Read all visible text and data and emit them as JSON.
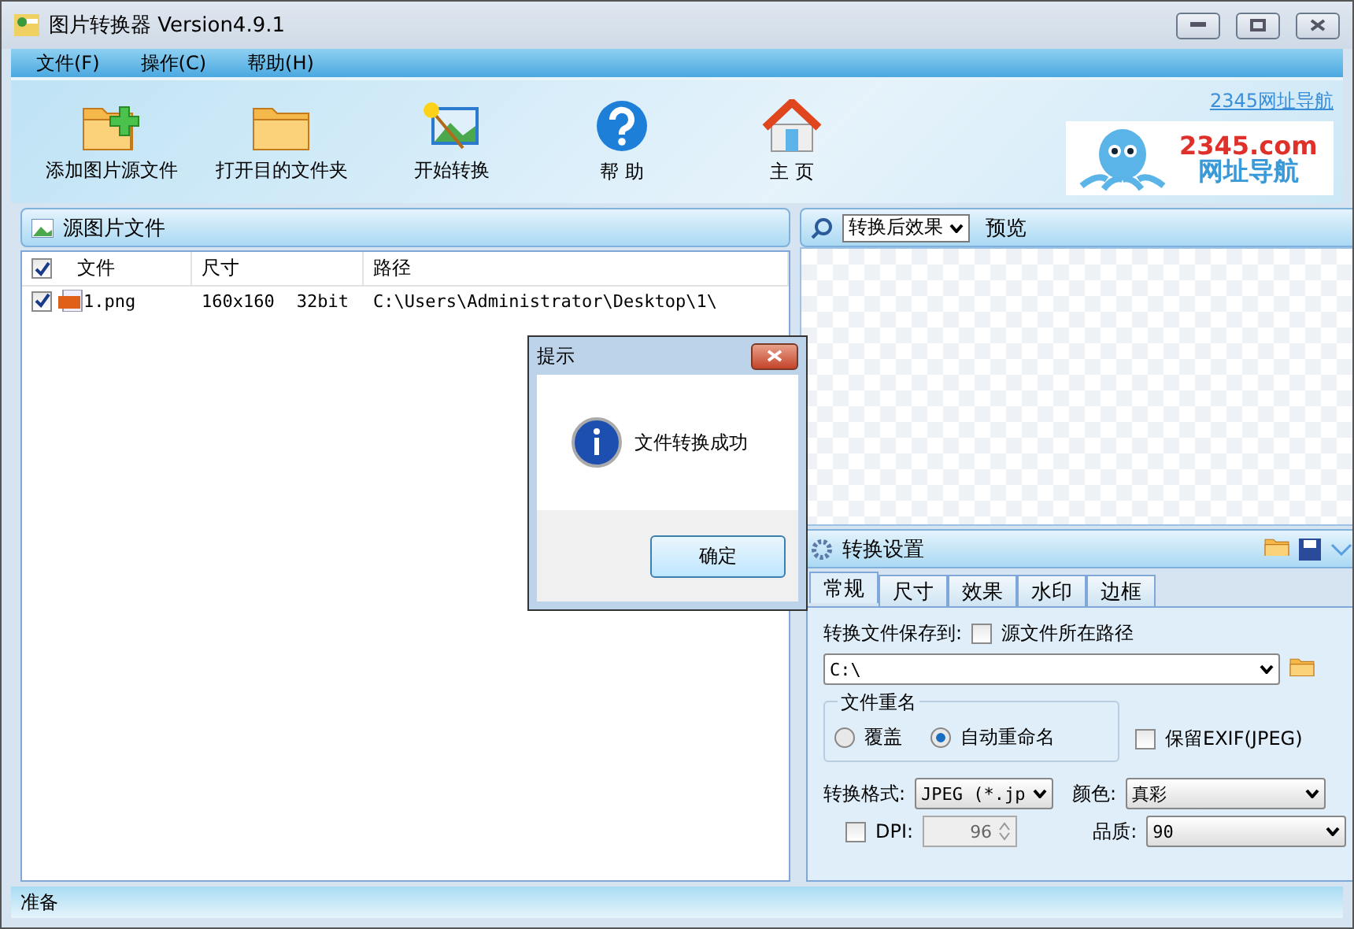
{
  "window": {
    "title": "图片转换器 Version4.9.1"
  },
  "menu": [
    "文件(F)",
    "操作(C)",
    "帮助(H)"
  ],
  "toolbar": [
    {
      "kind": "add",
      "label": "添加图片源文件"
    },
    {
      "kind": "folder",
      "label": "打开目的文件夹"
    },
    {
      "kind": "convert",
      "label": "开始转换"
    },
    {
      "kind": "help",
      "label": "帮 助"
    },
    {
      "kind": "home",
      "label": "主 页"
    }
  ],
  "banner": {
    "link": "2345网址导航",
    "brand": "2345.com",
    "tagline": "网址导航"
  },
  "source_panel": {
    "title": "源图片文件",
    "all_checked": true,
    "columns": [
      "文件",
      "尺寸",
      "路径"
    ],
    "rows": [
      {
        "checked": true,
        "file": "1.png",
        "dimensions": "160x160",
        "depth": "32bit",
        "path": "C:\\Users\\Administrator\\Desktop\\1\\"
      }
    ]
  },
  "preview": {
    "mode": "转换后效果",
    "label": "预览"
  },
  "settings": {
    "title": "转换设置",
    "tabs": [
      {
        "label": "常规",
        "selected": true
      },
      {
        "label": "尺寸",
        "selected": false
      },
      {
        "label": "效果",
        "selected": false
      },
      {
        "label": "水印",
        "selected": false
      },
      {
        "label": "边框",
        "selected": false
      }
    ],
    "save_to_label": "转换文件保存到:",
    "source_path": {
      "label": "源文件所在路径",
      "checked": false
    },
    "path": "C:\\",
    "rename": {
      "title": "文件重名",
      "options": [
        {
          "label": "覆盖",
          "selected": false
        },
        {
          "label": "自动重命名",
          "selected": true
        }
      ]
    },
    "keep_exif": {
      "label": "保留EXIF(JPEG)",
      "checked": false
    },
    "format": {
      "label": "转换格式:",
      "value": "JPEG (*.jp"
    },
    "color": {
      "label": "颜色:",
      "value": "真彩"
    },
    "dpi": {
      "label": "DPI:",
      "checked": false,
      "value": "96"
    },
    "quality": {
      "label": "品质:",
      "value": "90"
    }
  },
  "status_bar": "准备",
  "dialog": {
    "title": "提示",
    "message": "文件转换成功",
    "button": "确定"
  }
}
